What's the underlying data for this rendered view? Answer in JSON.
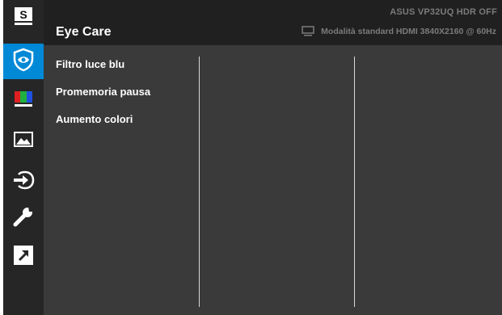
{
  "header": {
    "title": "Eye Care",
    "model": "ASUS  VP32UQ  HDR OFF",
    "mode": "Modalità standard HDMI 3840X2160 @ 60Hz",
    "mode_icon": "monitor-icon"
  },
  "sidebar": {
    "items": [
      {
        "icon": "splendid-s-icon"
      },
      {
        "icon": "eye-care-icon",
        "active": true
      },
      {
        "icon": "color-bars-icon"
      },
      {
        "icon": "image-icon"
      },
      {
        "icon": "input-select-icon"
      },
      {
        "icon": "system-setup-icon"
      },
      {
        "icon": "shortcut-icon"
      }
    ]
  },
  "menu": {
    "items": [
      {
        "label": "Filtro luce blu"
      },
      {
        "label": "Promemoria pausa"
      },
      {
        "label": "Aumento colori"
      }
    ]
  },
  "colors": {
    "accent": "#0089d6",
    "background": "#3a3a3a",
    "sidebar": "#262626",
    "header_text": "#7b7b7b"
  }
}
